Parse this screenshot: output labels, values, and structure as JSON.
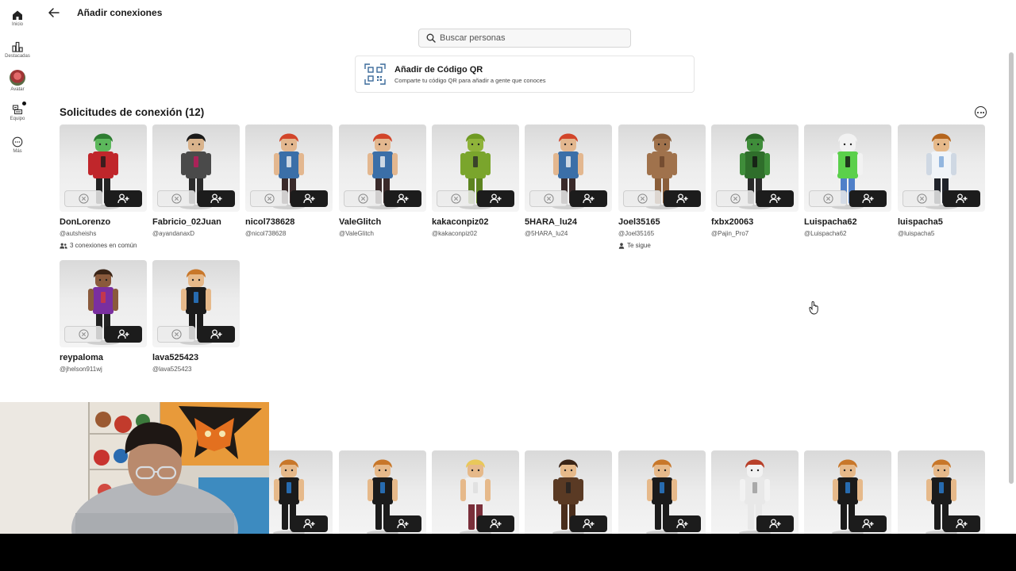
{
  "rail": {
    "items": [
      {
        "label": "Inicio",
        "icon": "home-icon"
      },
      {
        "label": "Destacadas",
        "icon": "charts-icon"
      },
      {
        "label": "Avatar",
        "icon": "avatar-icon"
      },
      {
        "label": "Equipo",
        "icon": "inventory-icon"
      },
      {
        "label": "Más",
        "icon": "more-icon"
      }
    ]
  },
  "header": {
    "title": "Añadir conexiones",
    "back_icon": "back-arrow-icon"
  },
  "search": {
    "placeholder": "Buscar personas"
  },
  "qr": {
    "title": "Añadir de Código QR",
    "subtitle": "Comparte tu código QR para añadir a gente que conoces"
  },
  "requests": {
    "title": "Solicitudes de conexión (12)",
    "cards": [
      {
        "name": "DonLorenzo",
        "handle": "@autsheishs",
        "meta": "3 conexiones en común",
        "meta_icon": "people-icon"
      },
      {
        "name": "Fabricio_02Juan",
        "handle": "@ayandanaxD",
        "meta": ""
      },
      {
        "name": "nicol738628",
        "handle": "@nicol738628",
        "meta": ""
      },
      {
        "name": "ValeGlitch",
        "handle": "@ValeGlitch",
        "meta": ""
      },
      {
        "name": "kakaconpiz02",
        "handle": "@kakaconpiz02",
        "meta": ""
      },
      {
        "name": "5HARA_lu24",
        "handle": "@5HARA_lu24",
        "meta": ""
      },
      {
        "name": "Joel35165",
        "handle": "@Joel35165",
        "meta": "Te sigue",
        "meta_icon": "person-icon"
      },
      {
        "name": "fxbx20063",
        "handle": "@Pajin_Pro7",
        "meta": ""
      },
      {
        "name": "Luispacha62",
        "handle": "@Luispacha62",
        "meta": ""
      },
      {
        "name": "luispacha5",
        "handle": "@luispacha5",
        "meta": ""
      },
      {
        "name": "reypaloma",
        "handle": "@jhelson911wj",
        "meta": ""
      },
      {
        "name": "lava525423",
        "handle": "@lava525423",
        "meta": ""
      }
    ]
  },
  "colors": {
    "accent": "#1c1c1c",
    "card_bg": "#e6e6e6"
  }
}
